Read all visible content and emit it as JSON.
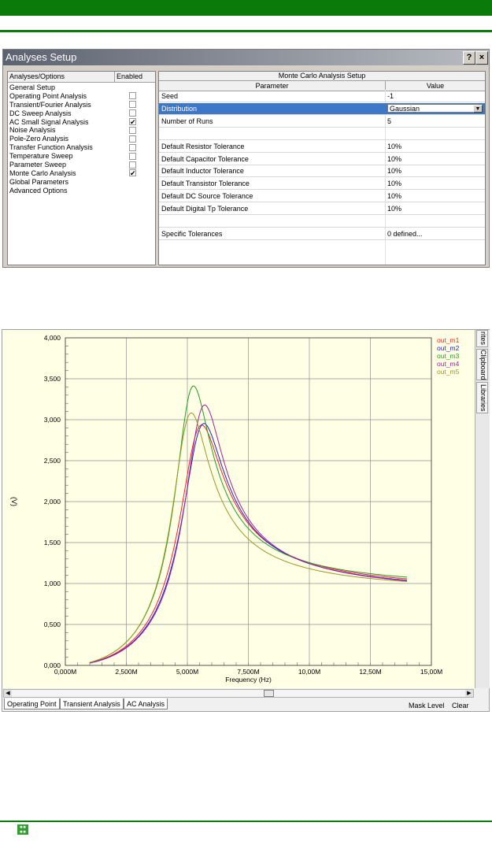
{
  "dialog": {
    "title": "Analyses Setup",
    "help_label": "?",
    "close_label": "×",
    "left_headers": [
      "Analyses/Options",
      "Enabled"
    ],
    "analyses": [
      {
        "label": "General Setup",
        "checkbox": false,
        "checked": false
      },
      {
        "label": "Operating Point Analysis",
        "checkbox": true,
        "checked": false
      },
      {
        "label": "Transient/Fourier Analysis",
        "checkbox": true,
        "checked": false
      },
      {
        "label": "DC Sweep Analysis",
        "checkbox": true,
        "checked": false
      },
      {
        "label": "AC Small Signal Analysis",
        "checkbox": true,
        "checked": true
      },
      {
        "label": "Noise Analysis",
        "checkbox": true,
        "checked": false
      },
      {
        "label": "Pole-Zero Analysis",
        "checkbox": true,
        "checked": false
      },
      {
        "label": "Transfer Function Analysis",
        "checkbox": true,
        "checked": false
      },
      {
        "label": "Temperature Sweep",
        "checkbox": true,
        "checked": false
      },
      {
        "label": "Parameter Sweep",
        "checkbox": true,
        "checked": false
      },
      {
        "label": "Monte Carlo Analysis",
        "checkbox": true,
        "checked": true
      },
      {
        "label": "Global Parameters",
        "checkbox": false,
        "checked": false
      },
      {
        "label": "Advanced Options",
        "checkbox": false,
        "checked": false
      }
    ],
    "setup_title": "Monte Carlo Analysis Setup",
    "param_header": "Parameter",
    "value_header": "Value",
    "params": [
      {
        "p": "Seed",
        "v": "-1"
      },
      {
        "p": "Distribution",
        "v": "Gaussian",
        "selected": true
      },
      {
        "p": "Number of Runs",
        "v": "5"
      },
      {
        "p": "",
        "v": ""
      },
      {
        "p": "Default Resistor Tolerance",
        "v": "10%"
      },
      {
        "p": "Default Capacitor Tolerance",
        "v": "10%"
      },
      {
        "p": "Default Inductor Tolerance",
        "v": "10%"
      },
      {
        "p": "Default Transistor Tolerance",
        "v": "10%"
      },
      {
        "p": "Default DC Source Tolerance",
        "v": "10%"
      },
      {
        "p": "Default Digital Tp Tolerance",
        "v": "10%"
      },
      {
        "p": "",
        "v": ""
      },
      {
        "p": "Specific Tolerances",
        "v": "0 defined..."
      }
    ]
  },
  "grapher": {
    "side_tabs": [
      "rites",
      "Clipboard",
      "Libraries"
    ],
    "bottom_tabs": [
      "Operating Point",
      "Transient Analysis",
      "AC Analysis"
    ],
    "mask_level_label": "Mask Level",
    "clear_label": "Clear",
    "colors": {
      "grid": "#909090",
      "text": "#000000"
    }
  },
  "chart_data": {
    "type": "line",
    "xlabel": "Frequency (Hz)",
    "ylabel": "(V)",
    "xlim": [
      0,
      15000000
    ],
    "ylim": [
      0,
      4
    ],
    "x_ticks": [
      {
        "v": 0,
        "label": "0,000M"
      },
      {
        "v": 2500000,
        "label": "2,500M"
      },
      {
        "v": 5000000,
        "label": "5,000M"
      },
      {
        "v": 7500000,
        "label": "7,500M"
      },
      {
        "v": 10000000,
        "label": "10,00M"
      },
      {
        "v": 12500000,
        "label": "12,50M"
      },
      {
        "v": 15000000,
        "label": "15,00M"
      }
    ],
    "y_ticks": [
      {
        "v": 0,
        "label": "0,000"
      },
      {
        "v": 0.5,
        "label": "0,500"
      },
      {
        "v": 1.0,
        "label": "1,000"
      },
      {
        "v": 1.5,
        "label": "1,500"
      },
      {
        "v": 2.0,
        "label": "2,000"
      },
      {
        "v": 2.5,
        "label": "2,500"
      },
      {
        "v": 3.0,
        "label": "3,000"
      },
      {
        "v": 3.5,
        "label": "3,500"
      },
      {
        "v": 4.0,
        "label": "4,000"
      }
    ],
    "grid": true,
    "legend_position": "top-right",
    "series": [
      {
        "name": "out_m1",
        "color": "#ff2020",
        "f0": 5450000,
        "peak": 2.9,
        "q": 3.2,
        "tail": 0.72
      },
      {
        "name": "out_m2",
        "color": "#2020e0",
        "f0": 5550000,
        "peak": 2.92,
        "q": 3.3,
        "tail": 0.73
      },
      {
        "name": "out_m3",
        "color": "#20a020",
        "f0": 5150000,
        "peak": 3.38,
        "q": 3.6,
        "tail": 0.72
      },
      {
        "name": "out_m4",
        "color": "#a020a0",
        "f0": 5600000,
        "peak": 3.15,
        "q": 3.6,
        "tail": 0.73
      },
      {
        "name": "out_m5",
        "color": "#9a9a20",
        "f0": 5050000,
        "peak": 3.05,
        "q": 3.4,
        "tail": 0.68
      }
    ],
    "x_start": 1000000,
    "x_end": 14000000
  }
}
